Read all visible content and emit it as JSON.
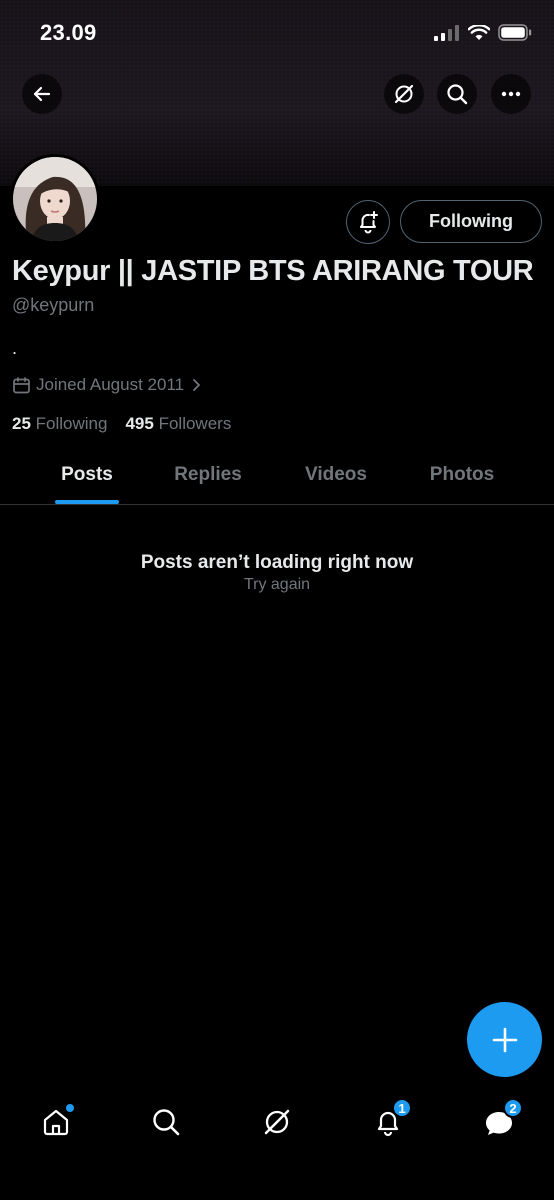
{
  "status_bar": {
    "time": "23.09",
    "icons": [
      "cellular-signal-icon",
      "wifi-icon",
      "battery-icon"
    ]
  },
  "header": {
    "icons": [
      "back-arrow-icon",
      "grok-icon",
      "search-icon",
      "more-icon"
    ]
  },
  "profile": {
    "display_name": "Keypur || JASTIP BTS ARIRANG TOUR",
    "handle": "@keypurn",
    "bio": ".",
    "joined": "Joined August 2011",
    "following_count": "25",
    "following_label": "Following",
    "followers_count": "495",
    "followers_label": "Followers",
    "follow_button": "Following"
  },
  "tabs": [
    {
      "label": "Posts",
      "active": true
    },
    {
      "label": "Replies",
      "active": false
    },
    {
      "label": "Videos",
      "active": false
    },
    {
      "label": "Photos",
      "active": false
    }
  ],
  "feed": {
    "error_title": "Posts aren’t loading right now",
    "retry_label": "Try again"
  },
  "bottom_nav": {
    "items": [
      "home-icon",
      "search-icon",
      "grok-icon",
      "notifications-icon",
      "messages-icon"
    ],
    "notifications_badge": "1",
    "messages_badge": "2"
  },
  "colors": {
    "background": "#000000",
    "accent": "#1d9bf0",
    "text_primary": "#e7e9ea",
    "text_secondary": "#71767b",
    "border": "#2f3336"
  }
}
